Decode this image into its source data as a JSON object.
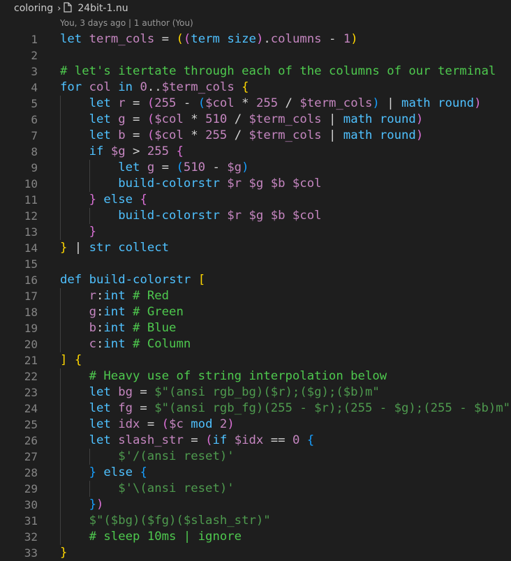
{
  "breadcrumb": {
    "folder": "coloring",
    "file": "24bit-1.nu"
  },
  "blame": "You, 3 days ago | 1 author (You)",
  "colors": {
    "keyword": "#569cd6",
    "control": "#c586c0",
    "variable": "#9cdcfe",
    "number": "#b5cea8",
    "string": "#ce9178",
    "comment": "#6a9955",
    "function": "#dcdcaa",
    "plain": "#d4d4d4",
    "bracket1": "#ffd700",
    "bracket2": "#da70d6",
    "bracket3": "#179fff"
  },
  "lines": [
    {
      "n": "1",
      "indent": 0,
      "tokens": [
        [
          "kw",
          "let"
        ],
        [
          "p",
          " "
        ],
        [
          "var",
          "term_cols"
        ],
        [
          "p",
          " = "
        ],
        [
          "b1",
          "("
        ],
        [
          "b2",
          "("
        ],
        [
          "kw",
          "term size"
        ],
        [
          "b2",
          ")"
        ],
        [
          "p",
          "."
        ],
        [
          "var",
          "columns"
        ],
        [
          "p",
          " - "
        ],
        [
          "num",
          "1"
        ],
        [
          "b1",
          ")"
        ]
      ]
    },
    {
      "n": "2",
      "indent": 0,
      "tokens": []
    },
    {
      "n": "3",
      "indent": 0,
      "tokens": [
        [
          "cm",
          "# let's itertate through each of the columns of our terminal"
        ]
      ]
    },
    {
      "n": "4",
      "indent": 0,
      "tokens": [
        [
          "kw",
          "for"
        ],
        [
          "p",
          " "
        ],
        [
          "var",
          "col"
        ],
        [
          "p",
          " "
        ],
        [
          "kw",
          "in"
        ],
        [
          "p",
          " "
        ],
        [
          "num",
          "0"
        ],
        [
          "p",
          ".."
        ],
        [
          "var",
          "$term_cols"
        ],
        [
          "p",
          " "
        ],
        [
          "b1",
          "{"
        ]
      ]
    },
    {
      "n": "5",
      "indent": 1,
      "tokens": [
        [
          "kw",
          "let"
        ],
        [
          "p",
          " "
        ],
        [
          "var",
          "r"
        ],
        [
          "p",
          " = "
        ],
        [
          "b2",
          "("
        ],
        [
          "num",
          "255"
        ],
        [
          "p",
          " - "
        ],
        [
          "b3",
          "("
        ],
        [
          "var",
          "$col"
        ],
        [
          "p",
          " * "
        ],
        [
          "num",
          "255"
        ],
        [
          "p",
          " / "
        ],
        [
          "var",
          "$term_cols"
        ],
        [
          "b3",
          ")"
        ],
        [
          "p",
          " | "
        ],
        [
          "fn",
          "math round"
        ],
        [
          "b2",
          ")"
        ]
      ]
    },
    {
      "n": "6",
      "indent": 1,
      "tokens": [
        [
          "kw",
          "let"
        ],
        [
          "p",
          " "
        ],
        [
          "var",
          "g"
        ],
        [
          "p",
          " = "
        ],
        [
          "b2",
          "("
        ],
        [
          "var",
          "$col"
        ],
        [
          "p",
          " * "
        ],
        [
          "num",
          "510"
        ],
        [
          "p",
          " / "
        ],
        [
          "var",
          "$term_cols"
        ],
        [
          "p",
          " | "
        ],
        [
          "fn",
          "math round"
        ],
        [
          "b2",
          ")"
        ]
      ]
    },
    {
      "n": "7",
      "indent": 1,
      "tokens": [
        [
          "kw",
          "let"
        ],
        [
          "p",
          " "
        ],
        [
          "var",
          "b"
        ],
        [
          "p",
          " = "
        ],
        [
          "b2",
          "("
        ],
        [
          "var",
          "$col"
        ],
        [
          "p",
          " * "
        ],
        [
          "num",
          "255"
        ],
        [
          "p",
          " / "
        ],
        [
          "var",
          "$term_cols"
        ],
        [
          "p",
          " | "
        ],
        [
          "fn",
          "math round"
        ],
        [
          "b2",
          ")"
        ]
      ]
    },
    {
      "n": "8",
      "indent": 1,
      "tokens": [
        [
          "kw",
          "if"
        ],
        [
          "p",
          " "
        ],
        [
          "var",
          "$g"
        ],
        [
          "p",
          " > "
        ],
        [
          "num",
          "255"
        ],
        [
          "p",
          " "
        ],
        [
          "b2",
          "{"
        ]
      ]
    },
    {
      "n": "9",
      "indent": 2,
      "tokens": [
        [
          "kw",
          "let"
        ],
        [
          "p",
          " "
        ],
        [
          "var",
          "g"
        ],
        [
          "p",
          " = "
        ],
        [
          "b3",
          "("
        ],
        [
          "num",
          "510"
        ],
        [
          "p",
          " - "
        ],
        [
          "var",
          "$g"
        ],
        [
          "b3",
          ")"
        ]
      ]
    },
    {
      "n": "10",
      "indent": 2,
      "tokens": [
        [
          "fn",
          "build-colorstr"
        ],
        [
          "p",
          " "
        ],
        [
          "var",
          "$r $g $b $col"
        ]
      ]
    },
    {
      "n": "11",
      "indent": 1,
      "tokens": [
        [
          "b2",
          "}"
        ],
        [
          "p",
          " "
        ],
        [
          "kw",
          "else"
        ],
        [
          "p",
          " "
        ],
        [
          "b2",
          "{"
        ]
      ]
    },
    {
      "n": "12",
      "indent": 2,
      "tokens": [
        [
          "fn",
          "build-colorstr"
        ],
        [
          "p",
          " "
        ],
        [
          "var",
          "$r $g $b $col"
        ]
      ]
    },
    {
      "n": "13",
      "indent": 1,
      "tokens": [
        [
          "b2",
          "}"
        ]
      ]
    },
    {
      "n": "14",
      "indent": 0,
      "tokens": [
        [
          "b1",
          "}"
        ],
        [
          "p",
          " | "
        ],
        [
          "fn",
          "str collect"
        ]
      ]
    },
    {
      "n": "15",
      "indent": 0,
      "tokens": []
    },
    {
      "n": "16",
      "indent": 0,
      "tokens": [
        [
          "kw",
          "def"
        ],
        [
          "p",
          " "
        ],
        [
          "fn",
          "build-colorstr"
        ],
        [
          "p",
          " "
        ],
        [
          "b1",
          "["
        ]
      ]
    },
    {
      "n": "17",
      "indent": 1,
      "tokens": [
        [
          "var",
          "r"
        ],
        [
          "p",
          ":"
        ],
        [
          "kw",
          "int"
        ],
        [
          "p",
          " "
        ],
        [
          "cm",
          "# Red"
        ]
      ]
    },
    {
      "n": "18",
      "indent": 1,
      "tokens": [
        [
          "var",
          "g"
        ],
        [
          "p",
          ":"
        ],
        [
          "kw",
          "int"
        ],
        [
          "p",
          " "
        ],
        [
          "cm",
          "# Green"
        ]
      ]
    },
    {
      "n": "19",
      "indent": 1,
      "tokens": [
        [
          "var",
          "b"
        ],
        [
          "p",
          ":"
        ],
        [
          "kw",
          "int"
        ],
        [
          "p",
          " "
        ],
        [
          "cm",
          "# Blue"
        ]
      ]
    },
    {
      "n": "20",
      "indent": 1,
      "tokens": [
        [
          "var",
          "c"
        ],
        [
          "p",
          ":"
        ],
        [
          "kw",
          "int"
        ],
        [
          "p",
          " "
        ],
        [
          "cm",
          "# Column"
        ]
      ]
    },
    {
      "n": "21",
      "indent": 0,
      "tokens": [
        [
          "b1",
          "]"
        ],
        [
          "p",
          " "
        ],
        [
          "b1",
          "{"
        ]
      ]
    },
    {
      "n": "22",
      "indent": 1,
      "tokens": [
        [
          "cm",
          "# Heavy use of string interpolation below"
        ]
      ]
    },
    {
      "n": "23",
      "indent": 1,
      "tokens": [
        [
          "kw",
          "let"
        ],
        [
          "p",
          " "
        ],
        [
          "var",
          "bg"
        ],
        [
          "p",
          " = "
        ],
        [
          "str",
          "$\"(ansi rgb_bg)($r);($g);($b)m\""
        ]
      ]
    },
    {
      "n": "24",
      "indent": 1,
      "tokens": [
        [
          "kw",
          "let"
        ],
        [
          "p",
          " "
        ],
        [
          "var",
          "fg"
        ],
        [
          "p",
          " = "
        ],
        [
          "str",
          "$\"(ansi rgb_fg)(255 - $r);(255 - $g);(255 - $b)m\""
        ]
      ]
    },
    {
      "n": "25",
      "indent": 1,
      "tokens": [
        [
          "kw",
          "let"
        ],
        [
          "p",
          " "
        ],
        [
          "var",
          "idx"
        ],
        [
          "p",
          " = "
        ],
        [
          "b2",
          "("
        ],
        [
          "var",
          "$c"
        ],
        [
          "p",
          " "
        ],
        [
          "kw",
          "mod"
        ],
        [
          "p",
          " "
        ],
        [
          "num",
          "2"
        ],
        [
          "b2",
          ")"
        ]
      ]
    },
    {
      "n": "26",
      "indent": 1,
      "tokens": [
        [
          "kw",
          "let"
        ],
        [
          "p",
          " "
        ],
        [
          "var",
          "slash_str"
        ],
        [
          "p",
          " = "
        ],
        [
          "b2",
          "("
        ],
        [
          "kw",
          "if"
        ],
        [
          "p",
          " "
        ],
        [
          "var",
          "$idx"
        ],
        [
          "p",
          " == "
        ],
        [
          "num",
          "0"
        ],
        [
          "p",
          " "
        ],
        [
          "b3",
          "{"
        ]
      ]
    },
    {
      "n": "27",
      "indent": 2,
      "tokens": [
        [
          "str",
          "$'/(ansi reset)'"
        ]
      ]
    },
    {
      "n": "28",
      "indent": 1,
      "tokens": [
        [
          "b3",
          "}"
        ],
        [
          "p",
          " "
        ],
        [
          "kw",
          "else"
        ],
        [
          "p",
          " "
        ],
        [
          "b3",
          "{"
        ]
      ]
    },
    {
      "n": "29",
      "indent": 2,
      "tokens": [
        [
          "str",
          "$'\\(ansi reset)'"
        ]
      ]
    },
    {
      "n": "30",
      "indent": 1,
      "tokens": [
        [
          "b3",
          "}"
        ],
        [
          "b2",
          ")"
        ]
      ]
    },
    {
      "n": "31",
      "indent": 1,
      "tokens": [
        [
          "str",
          "$\"($bg)($fg)($slash_str)\""
        ]
      ]
    },
    {
      "n": "32",
      "indent": 1,
      "tokens": [
        [
          "cm",
          "# sleep 10ms | ignore"
        ]
      ]
    },
    {
      "n": "33",
      "indent": 0,
      "tokens": [
        [
          "b1",
          "}"
        ]
      ]
    }
  ]
}
